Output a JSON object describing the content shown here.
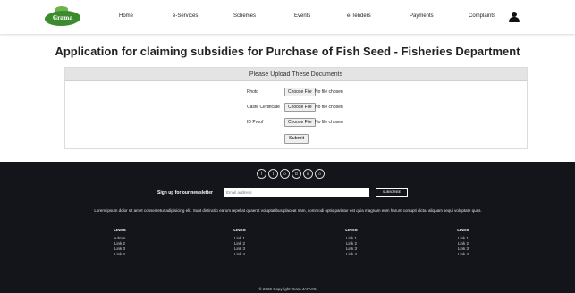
{
  "nav": {
    "logo_text": "Grama",
    "links": [
      "Home",
      "e-Services",
      "Schemes",
      "Events",
      "e-Tenders",
      "Payments",
      "Complaints"
    ]
  },
  "page_title": "Application for claiming subsidies for Purchase of Fish Seed - Fisheries Department",
  "upload": {
    "heading": "Please Upload These Documents",
    "fields": [
      {
        "label": "Photo",
        "button": "Choose File",
        "status": "No file chosen"
      },
      {
        "label": "Caste Certificate",
        "button": "Choose File",
        "status": "No file chosen"
      },
      {
        "label": "ID Proof",
        "button": "Choose File",
        "status": "No file chosen"
      }
    ],
    "submit_label": "Submit"
  },
  "footer": {
    "social_icons": [
      "facebook-icon",
      "twitter-icon",
      "instagram-icon",
      "google-icon",
      "linkedin-icon",
      "github-icon"
    ],
    "social_glyphs": [
      "f",
      "t",
      "o",
      "G",
      "in",
      "o"
    ],
    "newsletter_label": "Sign up for our newsletter",
    "email_placeholder": "Email address",
    "subscribe_label": "SUBSCRIBE",
    "lorem": "Lorem ipsum dolor sit amet consectetur adipisicing elit. Sunt distinctio earum repellat quaerat voluptatibus placeat nam, commodi optio pariatur est quia magnam eum harum corrupti dicta, aliquam sequi voluptate quas.",
    "columns": [
      {
        "heading": "LINKS",
        "items": [
          "Admin",
          "Link 2",
          "Link 3",
          "Link 4"
        ]
      },
      {
        "heading": "LINKS",
        "items": [
          "Link 1",
          "Link 2",
          "Link 3",
          "Link 4"
        ]
      },
      {
        "heading": "LINKS",
        "items": [
          "Link 1",
          "Link 2",
          "Link 3",
          "Link 4"
        ]
      },
      {
        "heading": "LINKS",
        "items": [
          "Link 1",
          "Link 2",
          "Link 3",
          "Link 4"
        ]
      }
    ],
    "copyright": "© 2022 Copyright Team JARVIS"
  },
  "colors": {
    "footer_bg": "#14151a",
    "logo_green": "#3d8b2f",
    "panel_header_bg": "#e4e4e4"
  }
}
